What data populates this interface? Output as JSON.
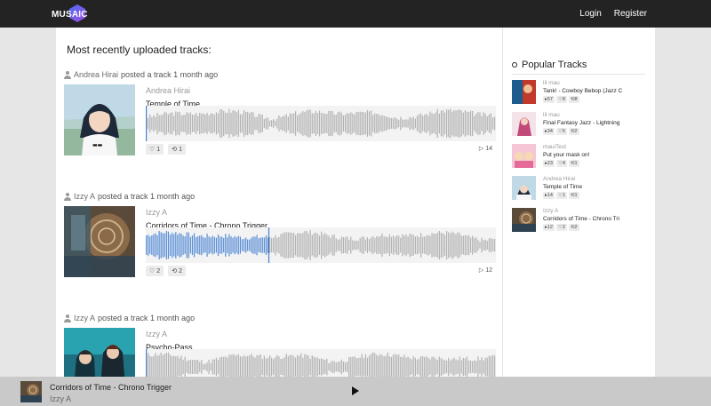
{
  "nav": {
    "logo": "MUSAIC",
    "login": "Login",
    "register": "Register"
  },
  "feed": {
    "heading": "Most recently uploaded tracks:",
    "posts": [
      {
        "author": "Andrea Hirai",
        "action": "posted a track 1 month ago",
        "artist": "Andrea Hirai",
        "title": "Temple of Time",
        "likes": "1",
        "reposts": "1",
        "plays": "14"
      },
      {
        "author": "Izzy A",
        "action": "posted a track 1 month ago",
        "artist": "Izzy A",
        "title": "Corridors of Time - Chrono Trigger",
        "likes": "2",
        "reposts": "2",
        "plays": "12",
        "progress": 0.35
      },
      {
        "author": "Izzy A",
        "action": "posted a track 1 month ago",
        "artist": "Izzy A",
        "title": "Psycho-Pass"
      }
    ]
  },
  "popular": {
    "title": "Popular Tracks",
    "items": [
      {
        "artist": "lil mau",
        "title": "Tank! - Cowboy Bebop (Jazz C",
        "plays": "57",
        "likes": "8",
        "reposts": "8"
      },
      {
        "artist": "lil mau",
        "title": "Final Fantasy Jazz - Lightning",
        "plays": "34",
        "likes": "5",
        "reposts": "2"
      },
      {
        "artist": "mauiTest",
        "title": "Put your mask on!",
        "plays": "23",
        "likes": "4",
        "reposts": "1"
      },
      {
        "artist": "Andrea Hirai",
        "title": "Temple of Time",
        "plays": "14",
        "likes": "1",
        "reposts": "1"
      },
      {
        "artist": "Izzy A",
        "title": "Corridors of Time - Chrono Tri",
        "plays": "12",
        "likes": "2",
        "reposts": "2"
      }
    ]
  },
  "player": {
    "title": "Corridors of Time - Chrono Trigger",
    "artist": "Izzy A"
  },
  "colors": {
    "topbar": "#232323",
    "wave_played": "#5b8fd6",
    "wave_unplayed": "#b3b3b3",
    "progress_line": "#4a7fcf"
  }
}
